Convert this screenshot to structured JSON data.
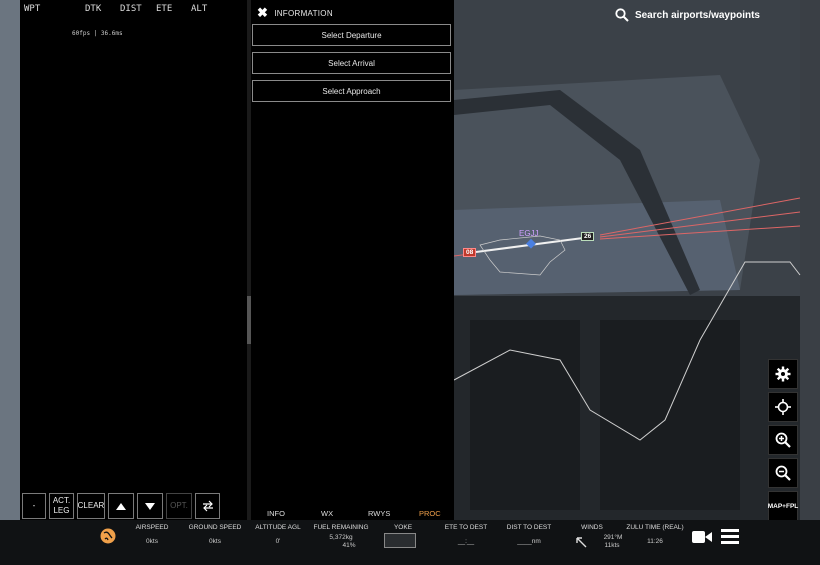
{
  "flightplan": {
    "columns": [
      "WPT",
      "DTK",
      "DIST",
      "ETE",
      "ALT"
    ],
    "fps": "60fps | 36.6ms",
    "buttons": {
      "minus": "-",
      "act_leg_line1": "ACT.",
      "act_leg_line2": "LEG",
      "clear": "CLEAR",
      "opt": "OPT."
    }
  },
  "information": {
    "title": "INFORMATION",
    "select_departure": "Select Departure",
    "select_arrival": "Select Arrival",
    "select_approach": "Select Approach",
    "tabs": [
      "INFO",
      "WX",
      "RWYS",
      "PROC"
    ],
    "active_tab": "PROC"
  },
  "search": {
    "label": "Search airports/waypoints"
  },
  "map": {
    "airport_code": "EGJJ",
    "runway_left": "08",
    "runway_right": "26",
    "map_fpl_label": "MAP+FPL"
  },
  "bottom_bar": {
    "airspeed_label": "AIRSPEED",
    "airspeed_value": "0kts",
    "ground_speed_label": "GROUND SPEED",
    "ground_speed_value": "0kts",
    "altitude_label": "ALTITUDE AGL",
    "altitude_value": "0'",
    "fuel_label": "FUEL REMAINING",
    "fuel_value": "5,372kg",
    "fuel_pct": "41%",
    "yoke_label": "YOKE",
    "ete_label": "ETE TO DEST",
    "ete_value": "__:__",
    "dist_label": "DIST TO DEST",
    "dist_value": "____nm",
    "winds_label": "WINDS",
    "winds_dir": "291°M",
    "winds_speed": "11kts",
    "zulu_label": "ZULU TIME (REAL)",
    "zulu_value": "11:26"
  },
  "colors": {
    "accent": "#f0a04a",
    "airport": "#d0a0ff",
    "route": "#e06a6a"
  }
}
